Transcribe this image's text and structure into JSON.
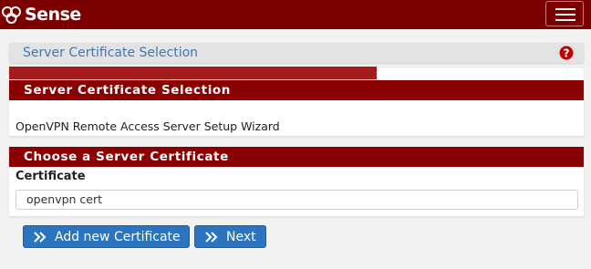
{
  "header": {
    "logo_text": "Sense",
    "menu_icon": "hamburger-menu-icon"
  },
  "breadcrumb": {
    "title": "Server Certificate Selection",
    "help_icon": "question-circle-icon"
  },
  "progress": {
    "percent": 64
  },
  "section_intro": {
    "heading": "Server Certificate Selection",
    "description": "OpenVPN Remote Access Server Setup Wizard"
  },
  "section_certificate": {
    "heading": "Choose a Server Certificate",
    "field_label": "Certificate",
    "selected_value": "openvpn cert"
  },
  "actions": {
    "add_label": "Add new Certificate",
    "next_label": "Next",
    "button_icon": "double-chevron-right-icon"
  },
  "colors": {
    "brand": "#7d0000",
    "accent": "#2a74c0",
    "progress": "#a51c1c"
  }
}
